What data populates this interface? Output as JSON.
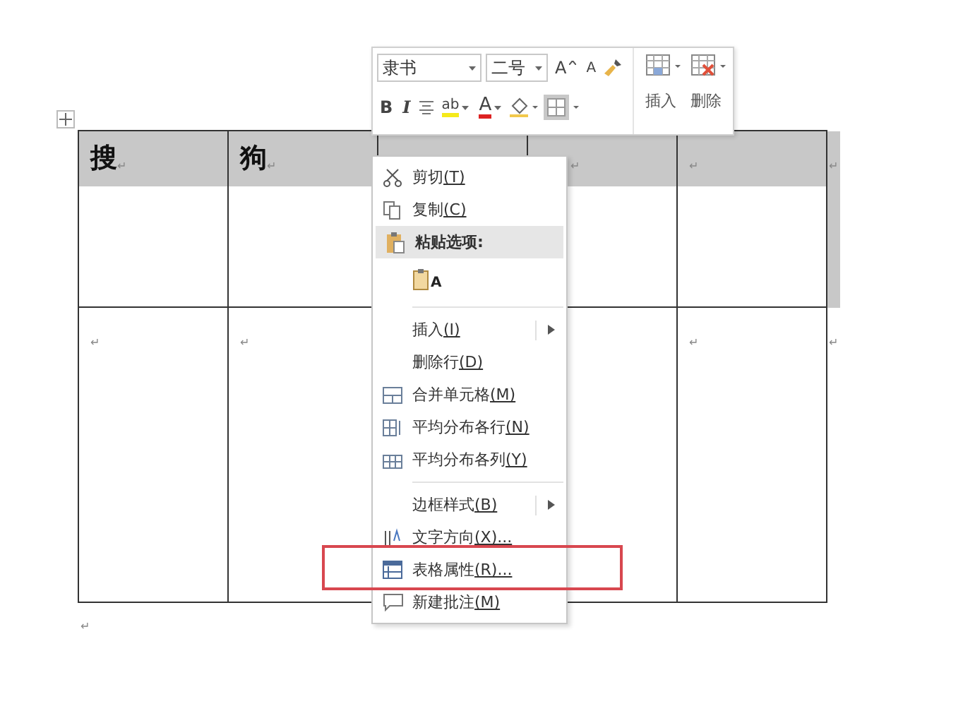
{
  "table": {
    "rows": [
      {
        "selected": true,
        "cells": [
          {
            "text": "搜",
            "mark": "↵"
          },
          {
            "text": "狗",
            "mark": "↵"
          },
          {},
          {
            "covered": true,
            "mark": "↵"
          },
          {
            "mark": "↵"
          }
        ],
        "end_mark": "↵"
      },
      {
        "selected": false,
        "cells": [
          {
            "mark": "↵"
          },
          {
            "mark": "↵"
          },
          null,
          {},
          {
            "mark": "↵"
          }
        ],
        "end_mark": "↵"
      }
    ]
  },
  "after_table_mark": "↵",
  "mini_toolbar": {
    "font": "隶书",
    "size": "二号",
    "row1": [
      {
        "kind": "grow",
        "label": "A"
      },
      {
        "kind": "shrink",
        "label": "A"
      },
      {
        "kind": "painter"
      }
    ],
    "row2": [
      {
        "kind": "bold",
        "label": "B"
      },
      {
        "kind": "italic",
        "label": "I"
      },
      {
        "kind": "align"
      },
      {
        "kind": "highlight",
        "label": "ab"
      },
      {
        "kind": "fontcolor",
        "label": "A"
      },
      {
        "kind": "shading"
      },
      {
        "kind": "borders"
      }
    ],
    "actions": [
      {
        "kind": "insert",
        "label": "插入"
      },
      {
        "kind": "delete",
        "label": "删除"
      }
    ]
  },
  "context_menu": {
    "items": [
      {
        "kind": "cut",
        "label": "剪切",
        "key": "(T)"
      },
      {
        "kind": "copy",
        "label": "复制",
        "key": "(C)"
      },
      {
        "kind": "paste-header",
        "label": "粘贴选项:"
      },
      {
        "kind": "paste-option",
        "label": "A"
      },
      {
        "kind": "separator"
      },
      {
        "kind": "insert",
        "label": "插入",
        "key": "(I)",
        "submenu": true
      },
      {
        "kind": "delete-row",
        "label": "删除行",
        "key": "(D)"
      },
      {
        "kind": "merge",
        "label": "合并单元格",
        "key": "(M)"
      },
      {
        "kind": "distribute-rows",
        "label": "平均分布各行",
        "key": "(N)"
      },
      {
        "kind": "distribute-columns",
        "label": "平均分布各列",
        "key": "(Y)"
      },
      {
        "kind": "separator"
      },
      {
        "kind": "border-style",
        "label": "边框样式",
        "key": "(B)",
        "submenu": true
      },
      {
        "kind": "text-direction",
        "label": "文字方向",
        "key": "(X)..."
      },
      {
        "kind": "table-properties",
        "label": "表格属性",
        "key": "(R)...",
        "highlighted": true
      },
      {
        "kind": "comment",
        "label": "新建批注",
        "key": "(M)"
      }
    ]
  }
}
